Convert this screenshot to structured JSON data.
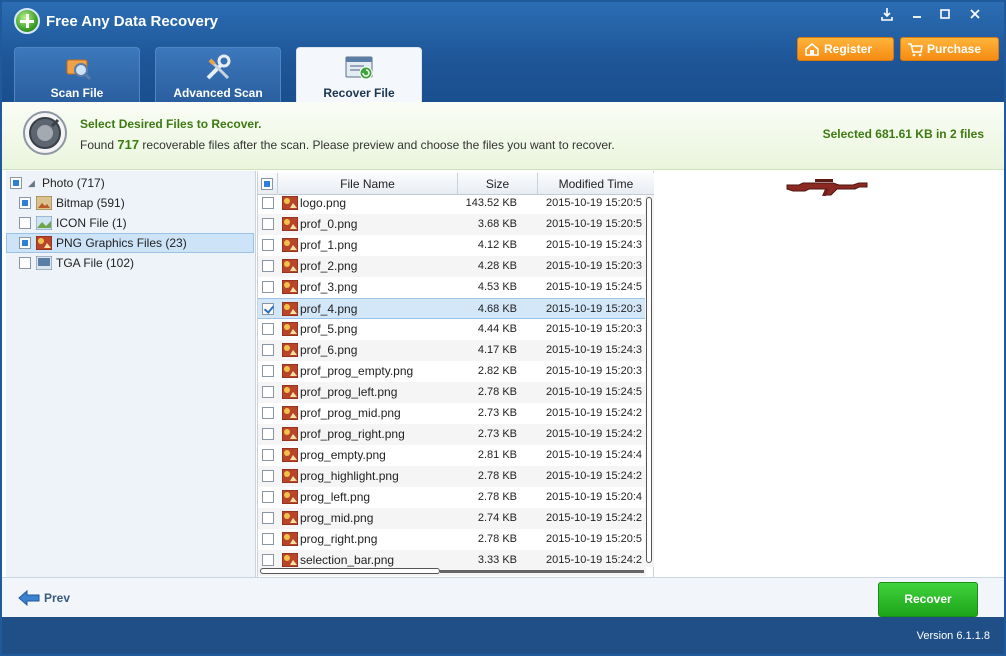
{
  "app": {
    "title": "Free Any Data Recovery",
    "version": "Version 6.1.1.8"
  },
  "window_controls": [
    "download-icon",
    "minimize-icon",
    "maximize-icon",
    "close-icon"
  ],
  "tabs": [
    {
      "label": "Scan File",
      "icon": "scan-file-icon",
      "active": false
    },
    {
      "label": "Advanced Scan",
      "icon": "tools-icon",
      "active": false
    },
    {
      "label": "Recover File",
      "icon": "recover-file-icon",
      "active": true
    }
  ],
  "header_buttons": {
    "register": "Register",
    "purchase": "Purchase"
  },
  "info": {
    "title": "Select Desired Files to Recover.",
    "text_prefix": "Found",
    "count": "717",
    "text_suffix": "recoverable files after the scan. Please preview and choose the files you want to recover.",
    "selected_summary": "Selected 681.61 KB in 2 files"
  },
  "tree": {
    "root": {
      "label": "Photo (717)",
      "check": "partial"
    },
    "items": [
      {
        "label": "Bitmap (591)",
        "check": "partial",
        "icon": "bitmap-icon",
        "selected": false
      },
      {
        "label": "ICON File (1)",
        "check": "none",
        "icon": "icon-file-icon",
        "selected": false
      },
      {
        "label": "PNG Graphics Files (23)",
        "check": "partial",
        "icon": "png-icon",
        "selected": true
      },
      {
        "label": "TGA File (102)",
        "check": "none",
        "icon": "tga-icon",
        "selected": false
      }
    ]
  },
  "table": {
    "headers": {
      "name": "File Name",
      "size": "Size",
      "time": "Modified Time"
    },
    "rows": [
      {
        "name": "logo.png",
        "size": "143.52 KB",
        "time": "2015-10-19 15:20:5",
        "checked": false
      },
      {
        "name": "prof_0.png",
        "size": "3.68 KB",
        "time": "2015-10-19 15:20:5",
        "checked": false
      },
      {
        "name": "prof_1.png",
        "size": "4.12 KB",
        "time": "2015-10-19 15:24:3",
        "checked": false
      },
      {
        "name": "prof_2.png",
        "size": "4.28 KB",
        "time": "2015-10-19 15:20:3",
        "checked": false
      },
      {
        "name": "prof_3.png",
        "size": "4.53 KB",
        "time": "2015-10-19 15:24:5",
        "checked": false
      },
      {
        "name": "prof_4.png",
        "size": "4.68 KB",
        "time": "2015-10-19 15:20:3",
        "checked": true
      },
      {
        "name": "prof_5.png",
        "size": "4.44 KB",
        "time": "2015-10-19 15:20:3",
        "checked": false
      },
      {
        "name": "prof_6.png",
        "size": "4.17 KB",
        "time": "2015-10-19 15:24:3",
        "checked": false
      },
      {
        "name": "prof_prog_empty.png",
        "size": "2.82 KB",
        "time": "2015-10-19 15:20:3",
        "checked": false
      },
      {
        "name": "prof_prog_left.png",
        "size": "2.78 KB",
        "time": "2015-10-19 15:24:5",
        "checked": false
      },
      {
        "name": "prof_prog_mid.png",
        "size": "2.73 KB",
        "time": "2015-10-19 15:24:2",
        "checked": false
      },
      {
        "name": "prof_prog_right.png",
        "size": "2.73 KB",
        "time": "2015-10-19 15:24:2",
        "checked": false
      },
      {
        "name": "prog_empty.png",
        "size": "2.81 KB",
        "time": "2015-10-19 15:24:4",
        "checked": false
      },
      {
        "name": "prog_highlight.png",
        "size": "2.78 KB",
        "time": "2015-10-19 15:24:2",
        "checked": false
      },
      {
        "name": "prog_left.png",
        "size": "2.78 KB",
        "time": "2015-10-19 15:20:4",
        "checked": false
      },
      {
        "name": "prog_mid.png",
        "size": "2.74 KB",
        "time": "2015-10-19 15:24:2",
        "checked": false
      },
      {
        "name": "prog_right.png",
        "size": "2.78 KB",
        "time": "2015-10-19 15:20:5",
        "checked": false
      },
      {
        "name": "selection_bar.png",
        "size": "3.33 KB",
        "time": "2015-10-19 15:24:2",
        "checked": false
      }
    ]
  },
  "preview": {
    "icon": "rifle-image"
  },
  "footer": {
    "prev": "Prev",
    "recover": "Recover"
  },
  "colors": {
    "titlebar": "#1d5597",
    "accent_green": "#3d7a12",
    "recover_green": "#1da41a",
    "orange": "#f58b12",
    "selection": "#cde3f7"
  }
}
